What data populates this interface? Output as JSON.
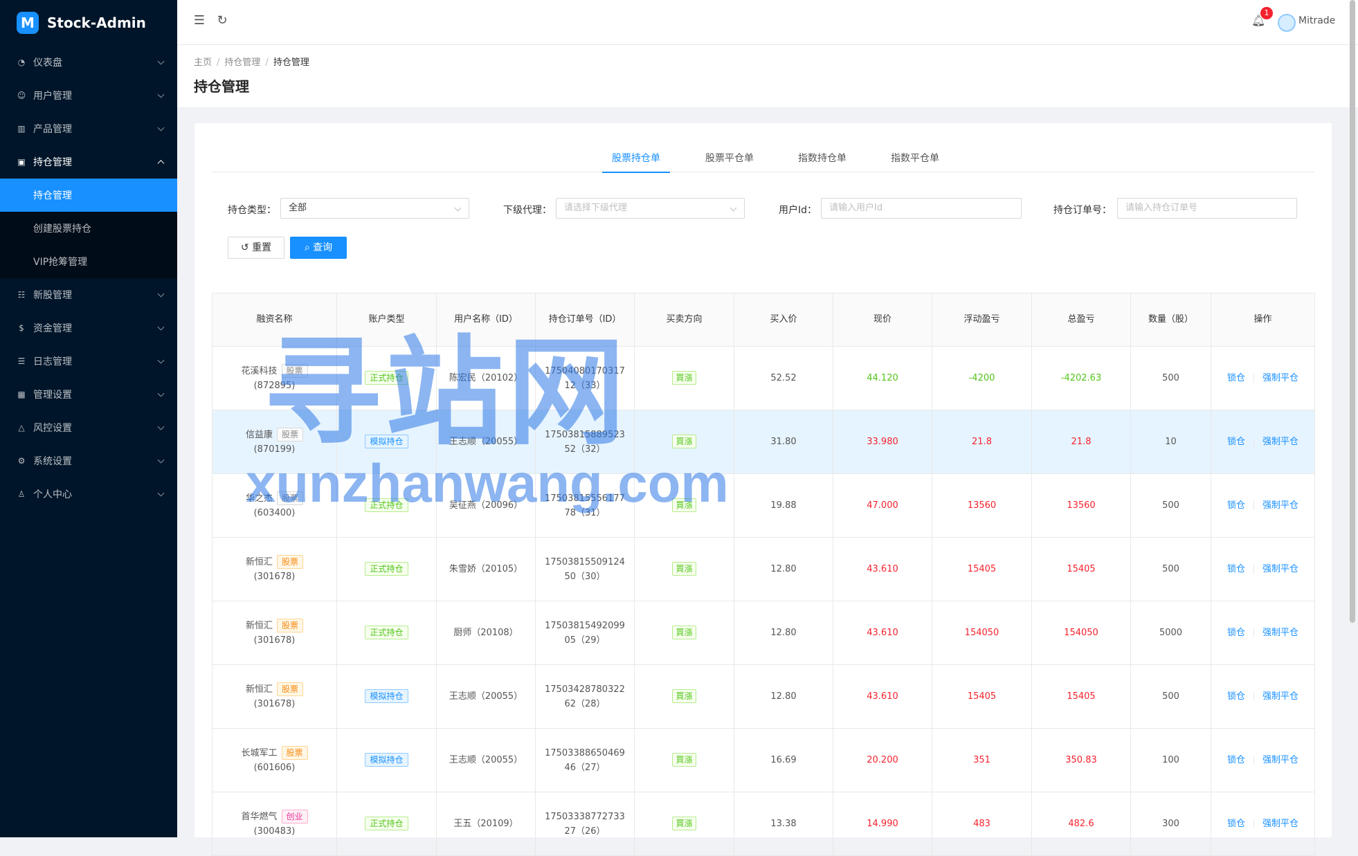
{
  "app": {
    "logo_mark": "M",
    "title": "Stock-Admin"
  },
  "sidebar": {
    "items": [
      {
        "label": "仪表盘",
        "icon": "dashboard-icon",
        "glyph": "◔"
      },
      {
        "label": "用户管理",
        "icon": "users-icon",
        "glyph": "☺"
      },
      {
        "label": "产品管理",
        "icon": "bar-chart-icon",
        "glyph": "▥"
      },
      {
        "label": "持仓管理",
        "icon": "position-icon",
        "glyph": "▣"
      },
      {
        "label": "新股管理",
        "icon": "new-stock-icon",
        "glyph": "☷"
      },
      {
        "label": "资金管理",
        "icon": "money-icon",
        "glyph": "$"
      },
      {
        "label": "日志管理",
        "icon": "log-icon",
        "glyph": "☰"
      },
      {
        "label": "管理设置",
        "icon": "admin-settings-icon",
        "glyph": "▦"
      },
      {
        "label": "风控设置",
        "icon": "warning-icon",
        "glyph": "△"
      },
      {
        "label": "系统设置",
        "icon": "gear-icon",
        "glyph": "⚙"
      },
      {
        "label": "个人中心",
        "icon": "user-icon",
        "glyph": "♙"
      }
    ],
    "sub_items": [
      "持仓管理",
      "创建股票持仓",
      "VIP抢筹管理"
    ]
  },
  "header": {
    "notification_count": "1",
    "username": "Mitrade"
  },
  "breadcrumb": [
    "主页",
    "持仓管理",
    "持仓管理"
  ],
  "page_title": "持仓管理",
  "tabs": [
    "股票持仓单",
    "股票平仓单",
    "指数持仓单",
    "指数平仓单"
  ],
  "filters": {
    "type_label": "持仓类型：",
    "type_value": "全部",
    "agent_label": "下级代理：",
    "agent_placeholder": "请选择下级代理",
    "userid_label": "用户Id：",
    "userid_placeholder": "请输入用户Id",
    "order_label": "持仓订单号：",
    "order_placeholder": "请输入持仓订单号",
    "reset_label": "重置",
    "query_label": "查询"
  },
  "table": {
    "headers": [
      "融资名称",
      "账户类型",
      "用户名称（ID）",
      "持仓订单号（ID）",
      "买卖方向",
      "买入价",
      "现价",
      "浮动盈亏",
      "总盈亏",
      "数量（股）",
      "操作"
    ],
    "rows": [
      {
        "name": "花溪科技",
        "tag": "股票",
        "code": "(872895)",
        "account": "正式持仓",
        "user": "陈宏民（20102）",
        "order1": "17504080170317",
        "order2": "12（33）",
        "dir": "買漲",
        "buy": "52.52",
        "now": "44.120",
        "float": "-4200",
        "total": "-4202.63",
        "qty": "500"
      },
      {
        "name": "信益康",
        "tag": "股票",
        "code": "(870199)",
        "account": "模拟持仓",
        "user": "王志顺（20055）",
        "order1": "17503815889523",
        "order2": "52（32）",
        "dir": "買漲",
        "buy": "31.80",
        "now": "33.980",
        "float": "21.8",
        "total": "21.8",
        "qty": "10"
      },
      {
        "name": "华之杰",
        "tag": "股票",
        "code": "(603400)",
        "account": "正式持仓",
        "user": "吴征燕（20096）",
        "order1": "17503815556177",
        "order2": "78（31）",
        "dir": "買漲",
        "buy": "19.88",
        "now": "47.000",
        "float": "13560",
        "total": "13560",
        "qty": "500"
      },
      {
        "name": "新恒汇",
        "tag": "股票",
        "code": "(301678)",
        "account": "正式持仓",
        "user": "朱雪娇（20105）",
        "order1": "17503815509124",
        "order2": "50（30）",
        "dir": "買漲",
        "buy": "12.80",
        "now": "43.610",
        "float": "15405",
        "total": "15405",
        "qty": "500"
      },
      {
        "name": "新恒汇",
        "tag": "股票",
        "code": "(301678)",
        "account": "正式持仓",
        "user": "厨师（20108）",
        "order1": "17503815492099",
        "order2": "05（29）",
        "dir": "買漲",
        "buy": "12.80",
        "now": "43.610",
        "float": "154050",
        "total": "154050",
        "qty": "5000"
      },
      {
        "name": "新恒汇",
        "tag": "股票",
        "code": "(301678)",
        "account": "模拟持仓",
        "user": "王志顺（20055）",
        "order1": "17503428780322",
        "order2": "62（28）",
        "dir": "買漲",
        "buy": "12.80",
        "now": "43.610",
        "float": "15405",
        "total": "15405",
        "qty": "500"
      },
      {
        "name": "长城军工",
        "tag": "股票",
        "code": "(601606)",
        "account": "模拟持仓",
        "user": "王志顺（20055）",
        "order1": "17503388650469",
        "order2": "46（27）",
        "dir": "買漲",
        "buy": "16.69",
        "now": "20.200",
        "float": "351",
        "total": "350.83",
        "qty": "100"
      },
      {
        "name": "首华燃气",
        "tag": "创业",
        "code": "(300483)",
        "account": "正式持仓",
        "user": "王五（20109）",
        "order1": "17503338772733",
        "order2": "27（26）",
        "dir": "買漲",
        "buy": "13.38",
        "now": "14.990",
        "float": "483",
        "total": "482.6",
        "qty": "300"
      }
    ],
    "op_lock": "锁仓",
    "op_close": "强制平仓"
  },
  "watermark": {
    "big": "寻站网",
    "small": "xunzhanwang.com"
  }
}
